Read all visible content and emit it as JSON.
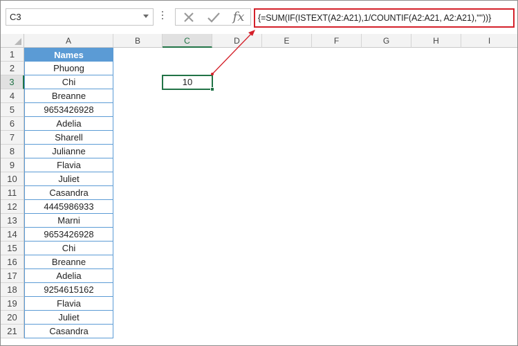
{
  "name_box": {
    "value": "C3"
  },
  "formula_bar": {
    "cancel_icon": "cross-icon",
    "enter_icon": "check-icon",
    "fx_label": "fx",
    "formula": "{=SUM(IF(ISTEXT(A2:A21),1/COUNTIF(A2:A21, A2:A21),\"\"))}"
  },
  "sheet": {
    "columns": [
      "A",
      "B",
      "C",
      "D",
      "E",
      "F",
      "G",
      "H",
      "I"
    ],
    "selected_column": "C",
    "rows": [
      "1",
      "2",
      "3",
      "4",
      "5",
      "6",
      "7",
      "8",
      "9",
      "10",
      "11",
      "12",
      "13",
      "14",
      "15",
      "16",
      "17",
      "18",
      "19",
      "20",
      "21"
    ],
    "selected_row": "3",
    "column_a": [
      "Names",
      "Phuong",
      "Chi",
      "Breanne",
      "9653426928",
      "Adelia",
      "Sharell",
      "Julianne",
      "Flavia",
      "Juliet",
      "Casandra",
      "4445986933",
      "Marni",
      "9653426928",
      "Chi",
      "Breanne",
      "Adelia",
      "9254615162",
      "Flavia",
      "Juliet",
      "Casandra"
    ],
    "c3_value": "10"
  },
  "colors": {
    "header_fill": "#5b9bd5",
    "selection": "#217346",
    "highlight": "#d4202a"
  }
}
